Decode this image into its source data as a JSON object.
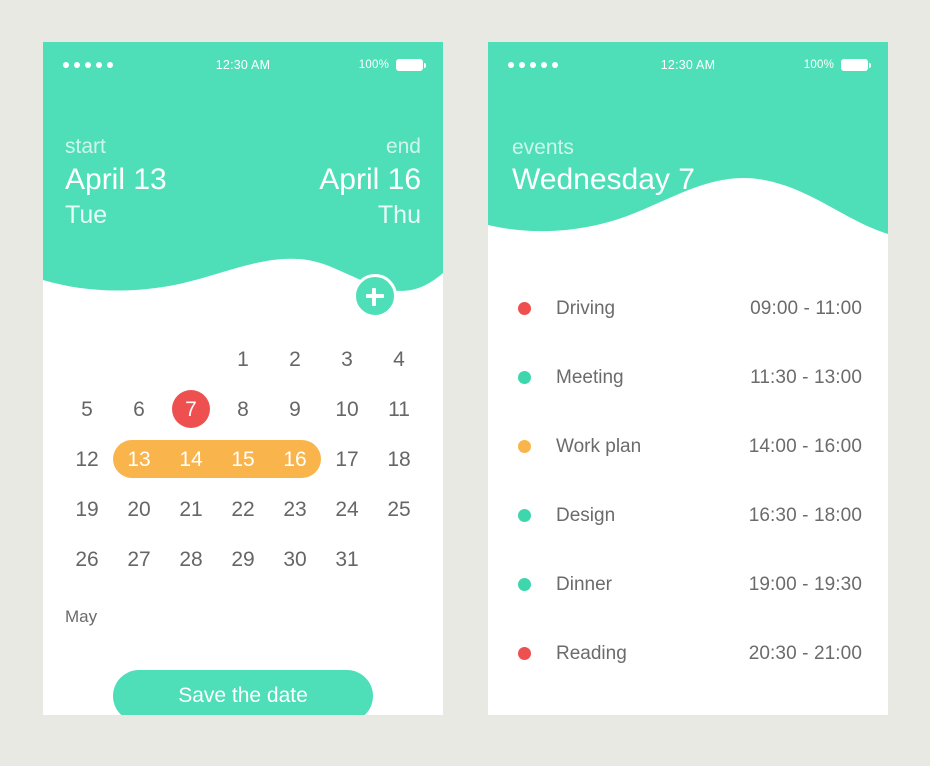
{
  "theme": {
    "background": "#e9e9e4",
    "card": "#ffffff",
    "teal": "#4fdfb8",
    "red": "#ee4f4f",
    "orange": "#f9b54c",
    "text_gray": "#6b6b6b"
  },
  "status_bar": {
    "signal_dots": 5,
    "time": "12:30 AM",
    "battery_percent": "100%",
    "battery_icon": "battery-full-icon"
  },
  "left_screen": {
    "range": {
      "start_label": "start",
      "start_date": "April 13",
      "start_day": "Tue",
      "end_label": "end",
      "end_date": "April 16",
      "end_day": "Thu"
    },
    "add_button": {
      "icon": "plus-icon",
      "label": "+"
    },
    "calendar": {
      "month_label": "May",
      "today": 7,
      "selected_range": [
        13,
        14,
        15,
        16
      ],
      "weeks": [
        [
          "",
          "",
          "",
          "1",
          "2",
          "3",
          "4"
        ],
        [
          "5",
          "6",
          "7",
          "8",
          "9",
          "10",
          "11"
        ],
        [
          "12",
          "13",
          "14",
          "15",
          "16",
          "17",
          "18"
        ],
        [
          "19",
          "20",
          "21",
          "22",
          "23",
          "24",
          "25"
        ],
        [
          "26",
          "27",
          "28",
          "29",
          "30",
          "31",
          ""
        ]
      ]
    },
    "save_button_label": "Save the date"
  },
  "right_screen": {
    "header": {
      "label": "events",
      "title": "Wednesday 7"
    },
    "events": [
      {
        "name": "Driving",
        "time": "09:00 - 11:00",
        "color": "#ee4f4f"
      },
      {
        "name": "Meeting",
        "time": "11:30 - 13:00",
        "color": "#3ed6ad"
      },
      {
        "name": "Work plan",
        "time": "14:00 - 16:00",
        "color": "#f9b54c"
      },
      {
        "name": "Design",
        "time": "16:30 - 18:00",
        "color": "#3ed6ad"
      },
      {
        "name": "Dinner",
        "time": "19:00 - 19:30",
        "color": "#3ed6ad"
      },
      {
        "name": "Reading",
        "time": "20:30 - 21:00",
        "color": "#ee4f4f"
      }
    ]
  }
}
